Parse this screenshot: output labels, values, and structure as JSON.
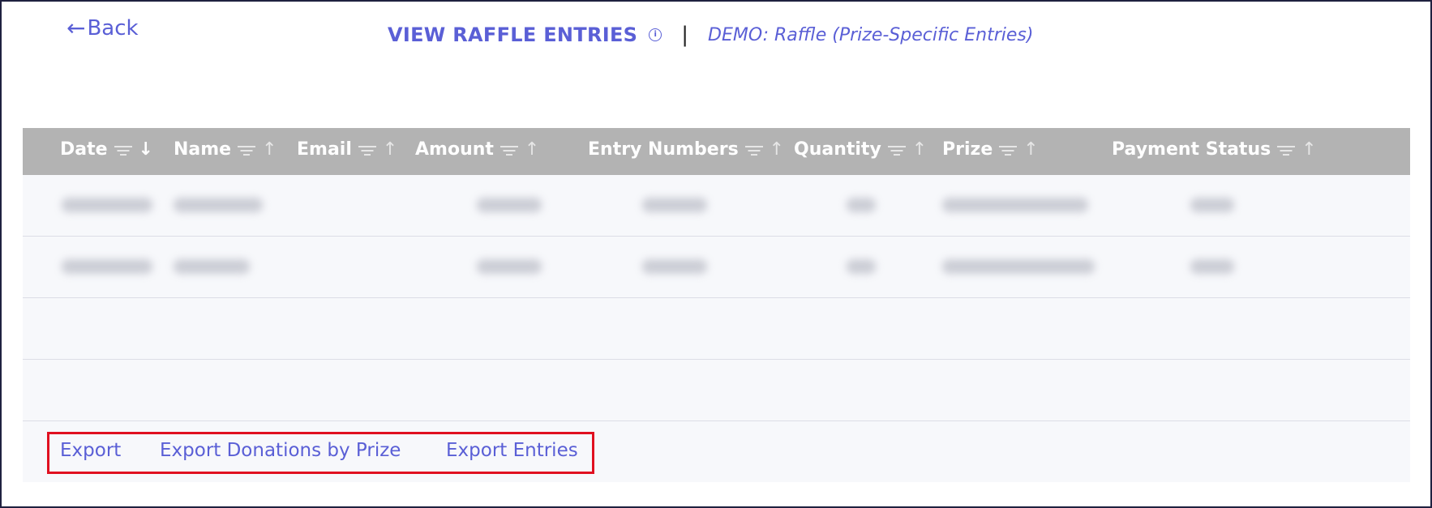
{
  "nav": {
    "back_label": "Back"
  },
  "header": {
    "title": "VIEW RAFFLE ENTRIES",
    "info_glyph": "i",
    "divider": "|",
    "event_name": "DEMO: Raffle (Prize-Specific Entries)"
  },
  "table": {
    "columns": [
      {
        "label": "Date",
        "sort": "desc"
      },
      {
        "label": "Name",
        "sort": "asc"
      },
      {
        "label": "Email",
        "sort": "asc"
      },
      {
        "label": "Amount",
        "sort": "asc"
      },
      {
        "label": "Entry Numbers",
        "sort": "asc"
      },
      {
        "label": "Quantity",
        "sort": "asc"
      },
      {
        "label": "Prize",
        "sort": "asc"
      },
      {
        "label": "Payment Status",
        "sort": "asc"
      }
    ],
    "rows_note": "row contents are blurred/redacted"
  },
  "footer": {
    "export_label": "Export",
    "export_by_prize_label": "Export Donations by Prize",
    "export_entries_label": "Export Entries"
  },
  "colors": {
    "accent": "#5a5fd6",
    "header_bg": "#b3b3b3",
    "highlight_box": "#e01020"
  }
}
